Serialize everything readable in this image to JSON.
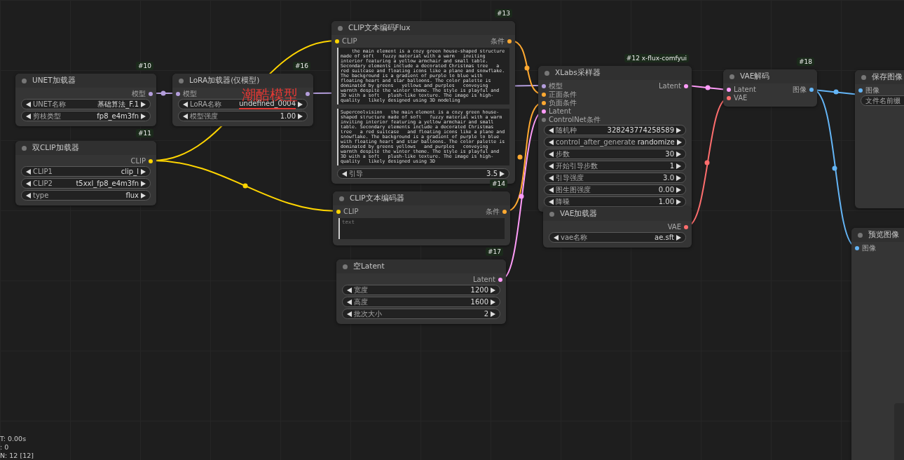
{
  "nodes": [
    {
      "badge": "#10",
      "title": "UNET加载器",
      "outputs": [
        {
          "label": "模型",
          "color": "#b39ddb"
        }
      ],
      "widgets": [
        {
          "kind": "combo",
          "label": "UNET名称",
          "value": "基础算法_F.1"
        },
        {
          "kind": "combo",
          "label": "剪枝类型",
          "value": "fp8_e4m3fn"
        }
      ]
    },
    {
      "badge": "#16",
      "title": "LoRA加载器(仅模型)",
      "inputs": [
        {
          "label": "模型",
          "color": "#b39ddb"
        }
      ],
      "outputs": [
        {
          "color": "#b39ddb"
        }
      ],
      "widgets": [
        {
          "kind": "combo",
          "label": "LoRA名称",
          "value": "undefined_0004",
          "underlined": true
        },
        {
          "kind": "number",
          "label": "模型强度",
          "value": "1.00"
        }
      ]
    },
    {
      "badge": "#11",
      "title": "双CLIP加载器",
      "outputs": [
        {
          "label": "CLIP",
          "color": "#ffd500"
        }
      ],
      "widgets": [
        {
          "kind": "combo",
          "label": "CLIP1",
          "value": "clip_l"
        },
        {
          "kind": "combo",
          "label": "CLIP2",
          "value": "t5xxl_fp8_e4m3fn"
        },
        {
          "kind": "combo",
          "label": "type",
          "value": "flux"
        }
      ]
    },
    {
      "badge": "#13",
      "title": "CLIP文本编码Flux",
      "inputs": [
        {
          "label": "CLIP",
          "color": "#ffd500"
        }
      ],
      "outputs": [
        {
          "label": "条件",
          "color": "#ffa931"
        }
      ],
      "widgets": [
        {
          "kind": "textarea",
          "value": "    the main element is a cozy green house-shaped structure made of soft   fuzzy material with a warm   inviting interior featuring a yellow armchair and small table. Secondary elements include a decorated Christmas tree   a red suitcase and floating icons like a plane and snowflake. The background is a gradient of purple to blue with floating heart and star balloons. The color palette is dominated by greens   yellows and purples   conveying warmth despite the winter theme. The style is playful and 3D with a soft   plush-like texture. The image is high-quality   likely designed using 3D modeling"
        },
        {
          "kind": "textarea",
          "value": "Supercoolvision   the main element is a cozy green house-shaped structure made of soft   fuzzy material with a warm inviting interior featuring a yellow armchair and small table. Secondary elements include a decorated Christmas tree   a red suitcase   and floating icons like a plane and snowflake. The background is a gradient of purple to blue with floating heart and star balloons. The color palette is dominated by greens yellows   and purples   conveying warmth despite the winter theme. The style is playful and 3D with a soft   plush-like texture. The image is high-quality   likely designed using 3D"
        },
        {
          "kind": "number",
          "label": "引导",
          "value": "3.5"
        }
      ]
    },
    {
      "badge": "#14",
      "title": "CLIP文本编码器",
      "inputs": [
        {
          "label": "CLIP",
          "color": "#ffd500"
        }
      ],
      "outputs": [
        {
          "label": "条件",
          "color": "#ffa931"
        }
      ],
      "widgets": [
        {
          "kind": "textarea",
          "placeholder": "text"
        }
      ]
    },
    {
      "badge": "#17",
      "title": "空Latent",
      "outputs": [
        {
          "label": "Latent",
          "color": "#ff9cf9"
        }
      ],
      "widgets": [
        {
          "kind": "number",
          "label": "宽度",
          "value": "1200"
        },
        {
          "kind": "number",
          "label": "高度",
          "value": "1600"
        },
        {
          "kind": "number",
          "label": "批次大小",
          "value": "2"
        }
      ]
    },
    {
      "badge": "#12 x-flux-comfyui",
      "title": "XLabs采样器",
      "inputs": [
        {
          "label": "模型",
          "color": "#b39ddb"
        },
        {
          "label": "正面条件",
          "color": "#ffa931"
        },
        {
          "label": "负面条件",
          "color": "#ffa931"
        },
        {
          "label": "Latent",
          "color": "#ff9cf9"
        },
        {
          "label": "ControlNet条件",
          "color": "#777777"
        }
      ],
      "outputs": [
        {
          "label": "Latent",
          "color": "#ff9cf9"
        }
      ],
      "widgets": [
        {
          "kind": "number",
          "label": "随机种",
          "value": "328243774258589"
        },
        {
          "kind": "combo",
          "label": "control_after_generate",
          "value": "randomize"
        },
        {
          "kind": "number",
          "label": "步数",
          "value": "30"
        },
        {
          "kind": "number",
          "label": "开始引导步数",
          "value": "1"
        },
        {
          "kind": "number",
          "label": "引导强度",
          "value": "3.0"
        },
        {
          "kind": "number",
          "label": "图生图强度",
          "value": "0.00"
        },
        {
          "kind": "number",
          "label": "降噪",
          "value": "1.00"
        }
      ]
    },
    {
      "title": "VAE加载器",
      "outputs": [
        {
          "label": "VAE",
          "color": "#ff6e6e"
        }
      ],
      "widgets": [
        {
          "kind": "combo",
          "label": "vae名称",
          "value": "ae.sft"
        }
      ]
    },
    {
      "badge": "#18",
      "title": "VAE解码",
      "inputs": [
        {
          "label": "Latent",
          "color": "#ff9cf9"
        },
        {
          "label": "VAE",
          "color": "#ff6e6e"
        }
      ],
      "outputs": [
        {
          "label": "图像",
          "color": "#64b5f6"
        }
      ]
    },
    {
      "title": "保存图像",
      "inputs": [
        {
          "label": "图像",
          "color": "#64b5f6"
        }
      ],
      "widgets": [
        {
          "kind": "text",
          "label": "文件名前缀"
        }
      ]
    },
    {
      "title": "预览图像",
      "inputs": [
        {
          "label": "图像",
          "color": "#64b5f6"
        }
      ]
    }
  ],
  "annotation": {
    "text": "潮酷模型"
  },
  "stats": [
    "T: 0.00s",
    ": 0",
    "N: 12 [12]"
  ]
}
